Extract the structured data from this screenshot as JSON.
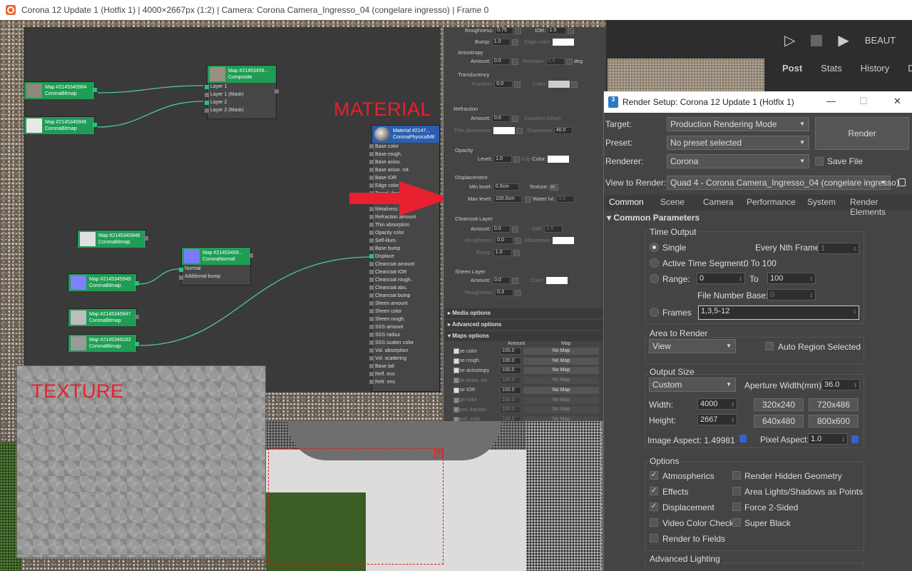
{
  "window": {
    "title": "Corona 12 Update 1 (Hotfix 1) | 4000×2667px (1:2) | Camera: Corona Camera_Ingresso_04 (congelare ingresso) | Frame 0"
  },
  "annotations": {
    "material": "MATERIAL",
    "texture": "TEXTURE"
  },
  "nodes": {
    "map1": {
      "title": "Map #2145345964",
      "sub": "CoronaBitmap"
    },
    "map2": {
      "title": "Map #2145345945",
      "sub": "CoronaBitmap"
    },
    "composite": {
      "title": "Map #21453459...",
      "sub": "Composite",
      "rows": [
        "Layer 1",
        "Layer 1 (Mask)",
        "Layer 2",
        "Layer 2 (Mask)"
      ]
    },
    "map3": {
      "title": "Map #2145345946",
      "sub": "CoronaBitmap"
    },
    "normal": {
      "title": "Map #21453459...",
      "sub": "CoronaNormal",
      "rows": [
        "Normal",
        "Additional bump"
      ]
    },
    "map4": {
      "title": "Map #2145345949",
      "sub": "CoronaBitmap"
    },
    "map5": {
      "title": "Map #2145345947",
      "sub": "CoronaBitmap"
    },
    "map6": {
      "title": "Map #2145346033",
      "sub": "CoronaBitmap"
    },
    "material": {
      "title": "Material #2147...",
      "sub": "CoronaPhysicalMtl",
      "rows": [
        "Base color",
        "Base rough.",
        "Base aniso.",
        "Base aniso. rot.",
        "Base IOR",
        "Edge color",
        "Transl. frac.",
        "Transl. color",
        "Metalness",
        "Refraction amount",
        "Thin absorption",
        "Opacity color",
        "Self-illum.",
        "Base bump",
        "Displace",
        "Clearcoat amount",
        "Clearcoat IOR",
        "Clearcoat rough.",
        "Clearcoat abs.",
        "Clearcoat bump",
        "Sheen amount",
        "Sheen color",
        "Sheen rough.",
        "SSS amount",
        "SSS radius",
        "SSS scatter color",
        "Vol. absorption",
        "Vol. scattering",
        "Base tail",
        "Refl. env.",
        "Refr. env."
      ]
    }
  },
  "matpanel": {
    "roughness_label": "Roughness:",
    "roughness_value": "0.75",
    "ior_label": "IOR:",
    "ior_value": "1.5",
    "bump_label": "Bump:",
    "bump_value": "1.0",
    "edge_color_label": "Edge color:",
    "anisotropy_title": "Anisotropy",
    "amount_label": "Amount:",
    "aniso_amount": "0.0",
    "rotation_label": "Rotation:",
    "rotation_value": "0.0",
    "deg": "deg",
    "translucency_title": "Translucency",
    "fraction_label": "Fraction:",
    "fraction_value": "0.0",
    "color_label": "Color:",
    "refraction_title": "Refraction",
    "refr_amount": "0.0",
    "caustics": "Caustics (slow)",
    "thin_absorption": "Thin absorption:",
    "dispersion": "Dispersion",
    "dispersion_value": "40.0",
    "opacity_title": "Opacity",
    "level_label": "Level:",
    "level_value": "1.0",
    "clip": "Clip",
    "displacement_title": "Displacement",
    "min_level_label": "Min level:",
    "min_level_value": "0.0cm",
    "texture_label": "Texture:",
    "texture_value": "m",
    "max_level_label": "Max level:",
    "max_level_value": "100.0cm",
    "water_lvl": "Water lvl.",
    "water_value": "0.5",
    "clearcoat_title": "Clearcoat Layer",
    "cc_amount": "0.0",
    "cc_ior": "1.5",
    "roughness_short": "Roughness:",
    "cc_rough": "0.0",
    "absorption_label": "Absorption:",
    "cc_bump": "1.0",
    "sheen_title": "Sheen Layer",
    "sheen_amount": "0.0",
    "sheen_rough": "0.3"
  },
  "rollouts": {
    "media": "Media options",
    "advanced": "Advanced options",
    "maps": "Maps options",
    "amount_col": "Amount",
    "map_col": "Map"
  },
  "maps_rows": [
    {
      "label": "Base color",
      "value": "100.0",
      "map": "No Map"
    },
    {
      "label": "Base rough.",
      "value": "100.0",
      "map": "No Map"
    },
    {
      "label": "Base anisotropy",
      "value": "100.0",
      "map": "No Map"
    },
    {
      "label": "Base aniso. rot.",
      "value": "100.0",
      "map": "No Map"
    },
    {
      "label": "Base IOR",
      "value": "100.0",
      "map": "No Map"
    },
    {
      "label": "Edge color",
      "value": "100.0",
      "map": "No Map"
    },
    {
      "label": "Transl. fraction",
      "value": "100.0",
      "map": "No Map"
    },
    {
      "label": "Transl. color",
      "value": "100.0",
      "map": "No Map"
    }
  ],
  "framebuffer": {
    "beauty": "BEAUT",
    "tabs": [
      "Post",
      "Stats",
      "History",
      "D"
    ]
  },
  "dialog": {
    "title": "Render Setup: Corona 12 Update 1 (Hotfix 1)",
    "target_label": "Target:",
    "target_value": "Production Rendering Mode",
    "preset_label": "Preset:",
    "preset_value": "No preset selected",
    "renderer_label": "Renderer:",
    "renderer_value": "Corona",
    "save_file": "Save File",
    "view_label": "View to Render:",
    "view_value": "Quad 4 - Corona Camera_Ingresso_04 (congelare ingresso)",
    "render_button": "Render",
    "tabs": [
      "Common",
      "Scene",
      "Camera",
      "Performance",
      "System",
      "Render Elements"
    ],
    "common_params": "Common Parameters",
    "time_output": "Time Output",
    "single": "Single",
    "every_nth": "Every Nth Frame:",
    "every_nth_value": "1",
    "active_segment": "Active Time Segment:",
    "active_range": "0 To 100",
    "range": "Range:",
    "range_from": "0",
    "to": "To",
    "range_to": "100",
    "file_number_base": "File Number Base:",
    "file_number_value": "0",
    "frames": "Frames",
    "frames_value": "1,3,5-12",
    "area_to_render": "Area to Render",
    "area_value": "View",
    "auto_region": "Auto Region Selected",
    "output_size": "Output Size",
    "size_preset": "Custom",
    "aperture_label": "Aperture Width(mm):",
    "aperture_value": "36.0",
    "width_label": "Width:",
    "width_value": "4000",
    "height_label": "Height:",
    "height_value": "2667",
    "preset_320": "320x240",
    "preset_720": "720x486",
    "preset_640": "640x480",
    "preset_800": "800x600",
    "image_aspect": "Image Aspect: 1.49981",
    "pixel_aspect_label": "Pixel Aspect:",
    "pixel_aspect_value": "1.0",
    "options": "Options",
    "atmospherics": "Atmospherics",
    "render_hidden": "Render Hidden Geometry",
    "effects": "Effects",
    "area_lights": "Area Lights/Shadows as Points",
    "displacement": "Displacement",
    "force_2sided": "Force 2-Sided",
    "video_color": "Video Color Check",
    "super_black": "Super Black",
    "render_fields": "Render to Fields",
    "advanced_lighting": "Advanced Lighting"
  }
}
